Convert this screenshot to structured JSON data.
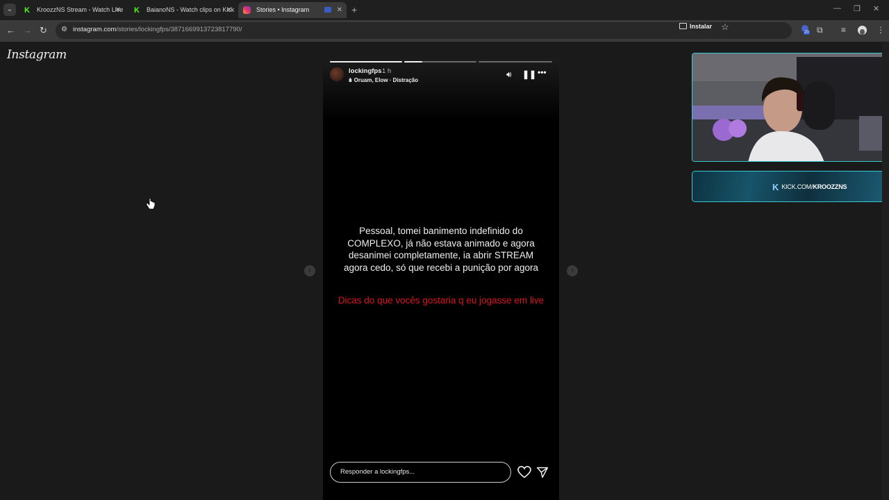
{
  "browser": {
    "tabs": [
      {
        "title": "KroozzNS Stream - Watch Live",
        "favicon": "kick-icon",
        "active": false
      },
      {
        "title": "BaianoNS - Watch clips on Kick",
        "favicon": "kick-icon",
        "active": false
      },
      {
        "title": "Stories • Instagram",
        "favicon": "instagram-icon",
        "active": true
      }
    ],
    "close_glyph": "✕",
    "new_tab_glyph": "+",
    "url_host": "instagram.com",
    "url_path": "/stories/lockingfps/3871669913723817790/",
    "install_label": "Instalar",
    "extension_badge": "20",
    "window_controls": [
      "—",
      "❐",
      "✕"
    ]
  },
  "page": {
    "logo": "Instagram",
    "story": {
      "username": "lockingfps",
      "time": "1 h",
      "music": "Oruam, Elow · Distração",
      "progress_segments": [
        1,
        0.25,
        0
      ],
      "text_main": "Pessoal, tomei banimento indefinido do COMPLEXO, já não estava animado e agora desanimei completamente, ia abrir STREAM agora cedo, só que recebi a punição por agora",
      "text_red": "Dicas do que vocês gostaria q eu jogasse em live",
      "reply_placeholder": "Responder a lockingfps...",
      "accent_red": "#d8141f"
    },
    "nav_prev": "‹",
    "nav_next": "›"
  },
  "overlay": {
    "kick_domain": "KICK.COM/",
    "kick_channel": "KROOZZNS",
    "kick_logo": "K",
    "border_color": "#38c9d6"
  }
}
